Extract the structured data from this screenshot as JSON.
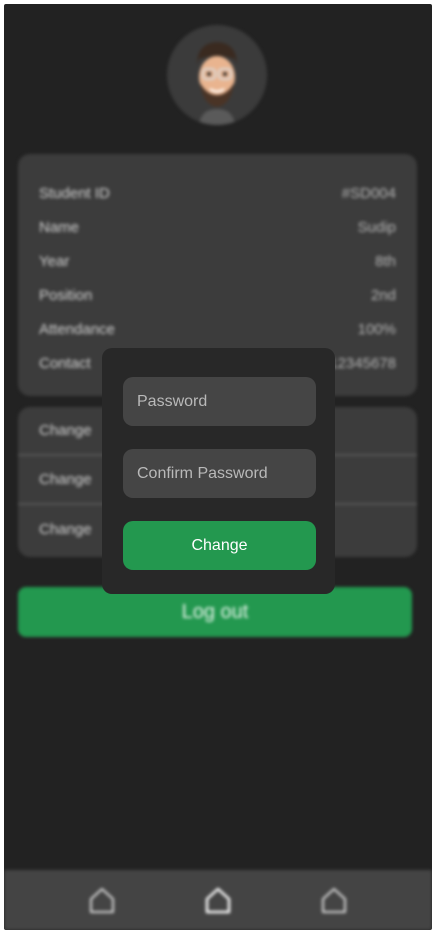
{
  "profile": {
    "avatar_icon": "memoji-avatar-icon",
    "fields": [
      {
        "label": "Student ID",
        "value": "#SD004"
      },
      {
        "label": "Name",
        "value": "Sudip"
      },
      {
        "label": "Year",
        "value": "8th"
      },
      {
        "label": "Position",
        "value": "2nd"
      },
      {
        "label": "Attendance",
        "value": "100%"
      },
      {
        "label": "Contact",
        "value": "12345678"
      }
    ]
  },
  "actions": [
    {
      "label": "Change"
    },
    {
      "label": "Change"
    },
    {
      "label": "Change"
    }
  ],
  "logout_label": "Log out",
  "bottom_nav": {
    "items": [
      {
        "icon": "home-icon"
      },
      {
        "icon": "home-icon"
      },
      {
        "icon": "home-icon"
      }
    ]
  },
  "modal": {
    "password_placeholder": "Password",
    "confirm_placeholder": "Confirm Password",
    "submit_label": "Change"
  },
  "colors": {
    "background": "#222222",
    "card": "#3c3c3c",
    "accent": "#23984f"
  }
}
